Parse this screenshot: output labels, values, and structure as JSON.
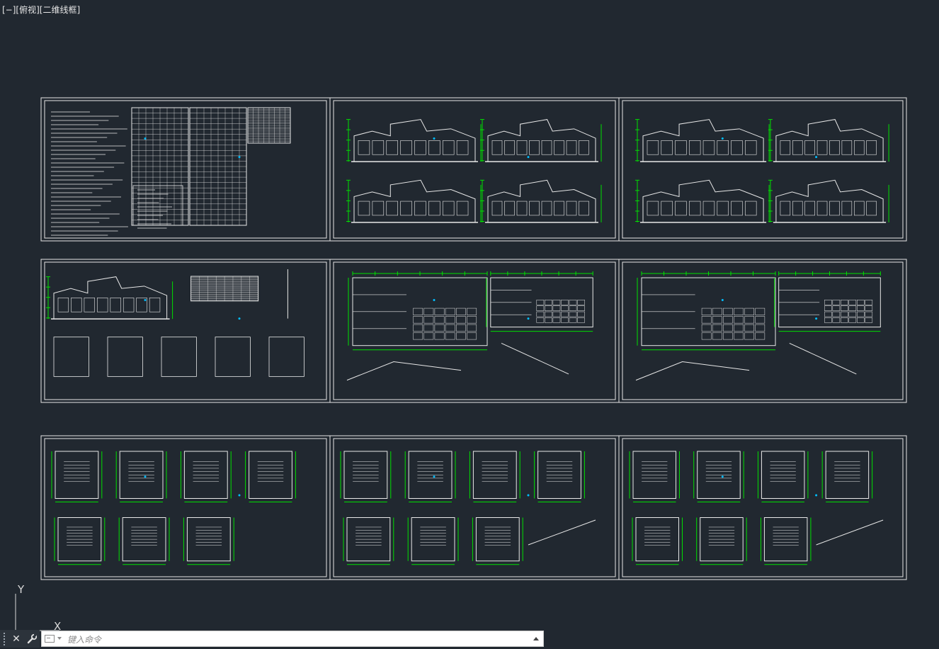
{
  "viewport": {
    "label": "[−][俯视][二维线框]"
  },
  "ucs": {
    "y_label": "Y",
    "x_label": "X"
  },
  "command_line": {
    "placeholder": "键入命令",
    "close_icon": "close-icon",
    "customize_icon": "wrench-icon"
  },
  "colors": {
    "background": "#212830",
    "sheet_border": "#e6e6e6",
    "geometry": "#e8e8e8",
    "dimension": "#00e000",
    "highlight": "#ff00ff",
    "accent": "#00bfff"
  }
}
